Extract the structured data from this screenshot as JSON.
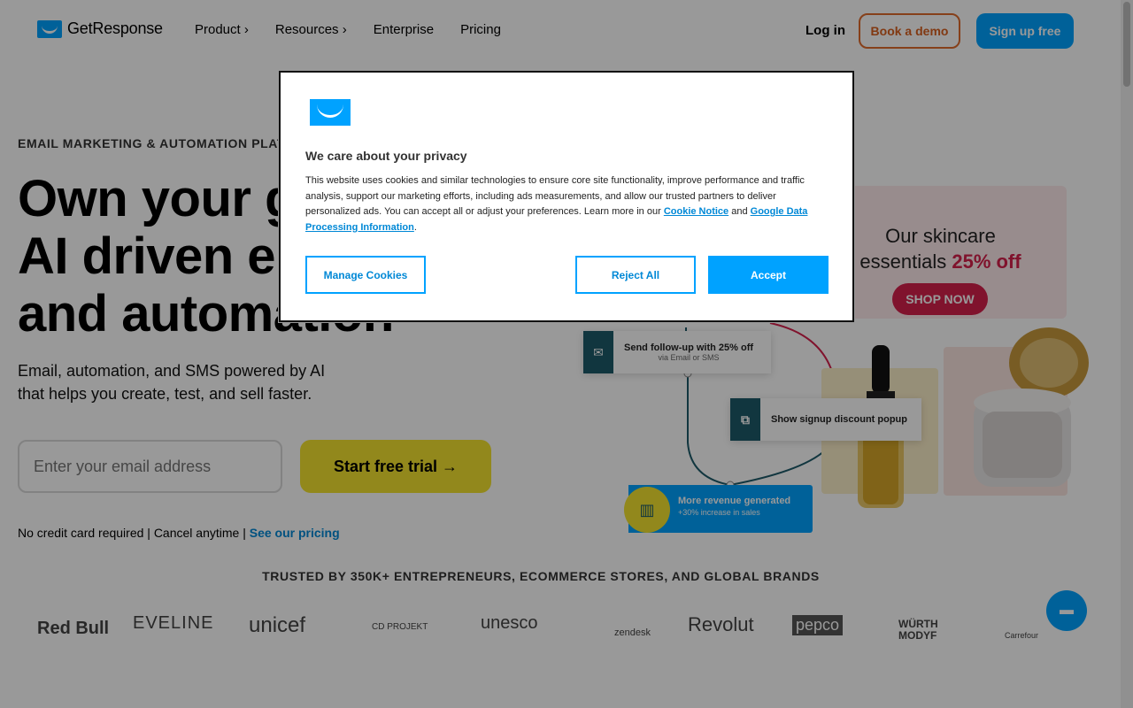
{
  "header": {
    "logo_text": "GetResponse",
    "nav": {
      "product": "Product ›",
      "resources": "Resources ›",
      "enterprise": "Enterprise",
      "pricing": "Pricing"
    },
    "login": "Log in",
    "book_demo": "Book a demo",
    "signup": "Sign up free"
  },
  "hero": {
    "eyebrow": "EMAIL MARKETING & AUTOMATION PLATFORM",
    "headline_line1": "Own your growth with",
    "headline_line2": "AI driven email",
    "headline_line3": "and automation",
    "subhead": "Email, automation, and SMS powered by AI that helps you create, test, and sell faster.",
    "email_placeholder": "Enter your email address",
    "cta": "Start free trial →",
    "fineprint": "No credit card required | Cancel anytime | ",
    "pricing_link": "See our pricing"
  },
  "illustration": {
    "skincare_line1": "Our skincare",
    "skincare_line2_prefix": "essentials ",
    "skincare_line2_highlight": "25% off",
    "shop_now": "SHOP NOW",
    "followup_title": "Send follow-up with 25% off",
    "followup_sub": "via Email or SMS",
    "popup_title": "Show signup discount popup",
    "revenue_title": "More revenue generated",
    "revenue_sub": "+30% increase in sales"
  },
  "trusted": {
    "title": "TRUSTED BY 350K+ ENTREPRENEURS, ECOMMERCE STORES, AND GLOBAL BRANDS",
    "brands": [
      "Red Bull",
      "EVELINE",
      "unicef",
      "CD PROJEKT",
      "unesco",
      "zendesk",
      "Revolut",
      "pepco",
      "WÜRTH MODYF",
      "Carrefour"
    ]
  },
  "cookie_modal": {
    "title": "We care about your privacy",
    "body": "This website uses cookies and similar technologies to ensure core site functionality, improve performance and traffic analysis, support our marketing efforts, including ads measurements, and allow our trusted partners to deliver personalized ads. You can accept all or adjust your preferences. Learn more in our ",
    "cookie_notice_link": "Cookie Notice",
    "and_text": " and ",
    "google_link": "Google Data Processing Information",
    "end_text": ".",
    "manage": "Manage Cookies",
    "reject": "Reject All",
    "accept": "Accept"
  },
  "colors": {
    "brand_blue": "#00a2ff",
    "cta_yellow": "#f3e32f",
    "demo_orange": "#e06b2c",
    "promo_pink": "#d6204c"
  }
}
